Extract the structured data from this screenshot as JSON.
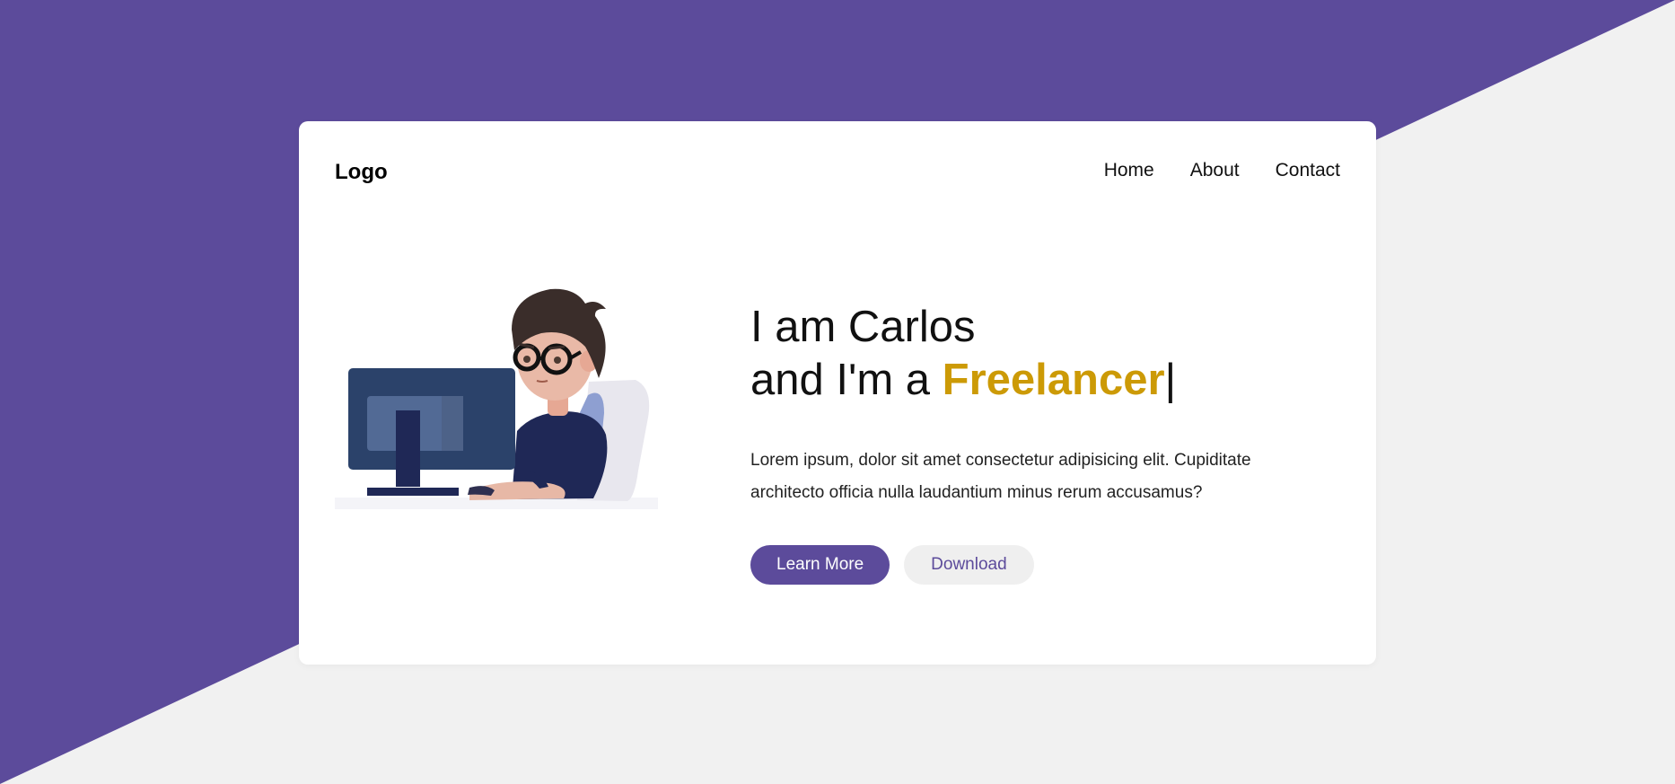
{
  "theme": {
    "purple": "#5c4b9b",
    "gold": "#cc9a06",
    "background": "#f1f1f1",
    "card": "#ffffff"
  },
  "navbar": {
    "logo": "Logo",
    "links": [
      "Home",
      "About",
      "Contact"
    ]
  },
  "hero": {
    "line1": "I am Carlos",
    "line2_prefix": "and I'm a ",
    "highlight": "Freelancer",
    "cursor": "|",
    "description": "Lorem ipsum, dolor sit amet consectetur adipisicing elit. Cupiditate architecto officia nulla laudantium minus rerum accusamus?",
    "primary_button": "Learn More",
    "secondary_button": "Download"
  },
  "illustration": {
    "icon": "person-at-computer-illustration"
  }
}
